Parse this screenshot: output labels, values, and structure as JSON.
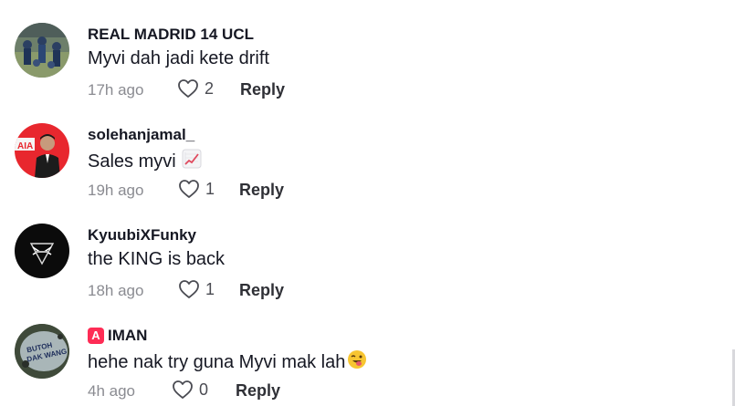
{
  "comments": [
    {
      "username": "REAL MADRID 14 UCL",
      "text": "Myvi dah jadi kete drift",
      "time": "17h ago",
      "likes": "2",
      "reply_label": "Reply",
      "avatar_icon": "football-team-photo"
    },
    {
      "username": "solehanjamal_",
      "text": "Sales myvi",
      "text_emoji": "chart-increasing-icon",
      "time": "19h ago",
      "likes": "1",
      "reply_label": "Reply",
      "avatar_icon": "person-photo-red-bg"
    },
    {
      "username": "KyuubiXFunky",
      "text": "the KING is back",
      "time": "18h ago",
      "likes": "1",
      "reply_label": "Reply",
      "avatar_icon": "black-logo"
    },
    {
      "username": "IMAN",
      "badge": "A",
      "text": "hehe nak try guna Myvi mak lah",
      "text_emoji": "winking-tongue-face-icon",
      "time": "4h ago",
      "likes": "0",
      "reply_label": "Reply",
      "avatar_icon": "button-photo",
      "avatar_text_1": "BUTOH",
      "avatar_text_2": "DAK WANG"
    }
  ],
  "colors": {
    "text": "#161823",
    "muted": "#8a8b91",
    "badge": "#fe2c55"
  }
}
